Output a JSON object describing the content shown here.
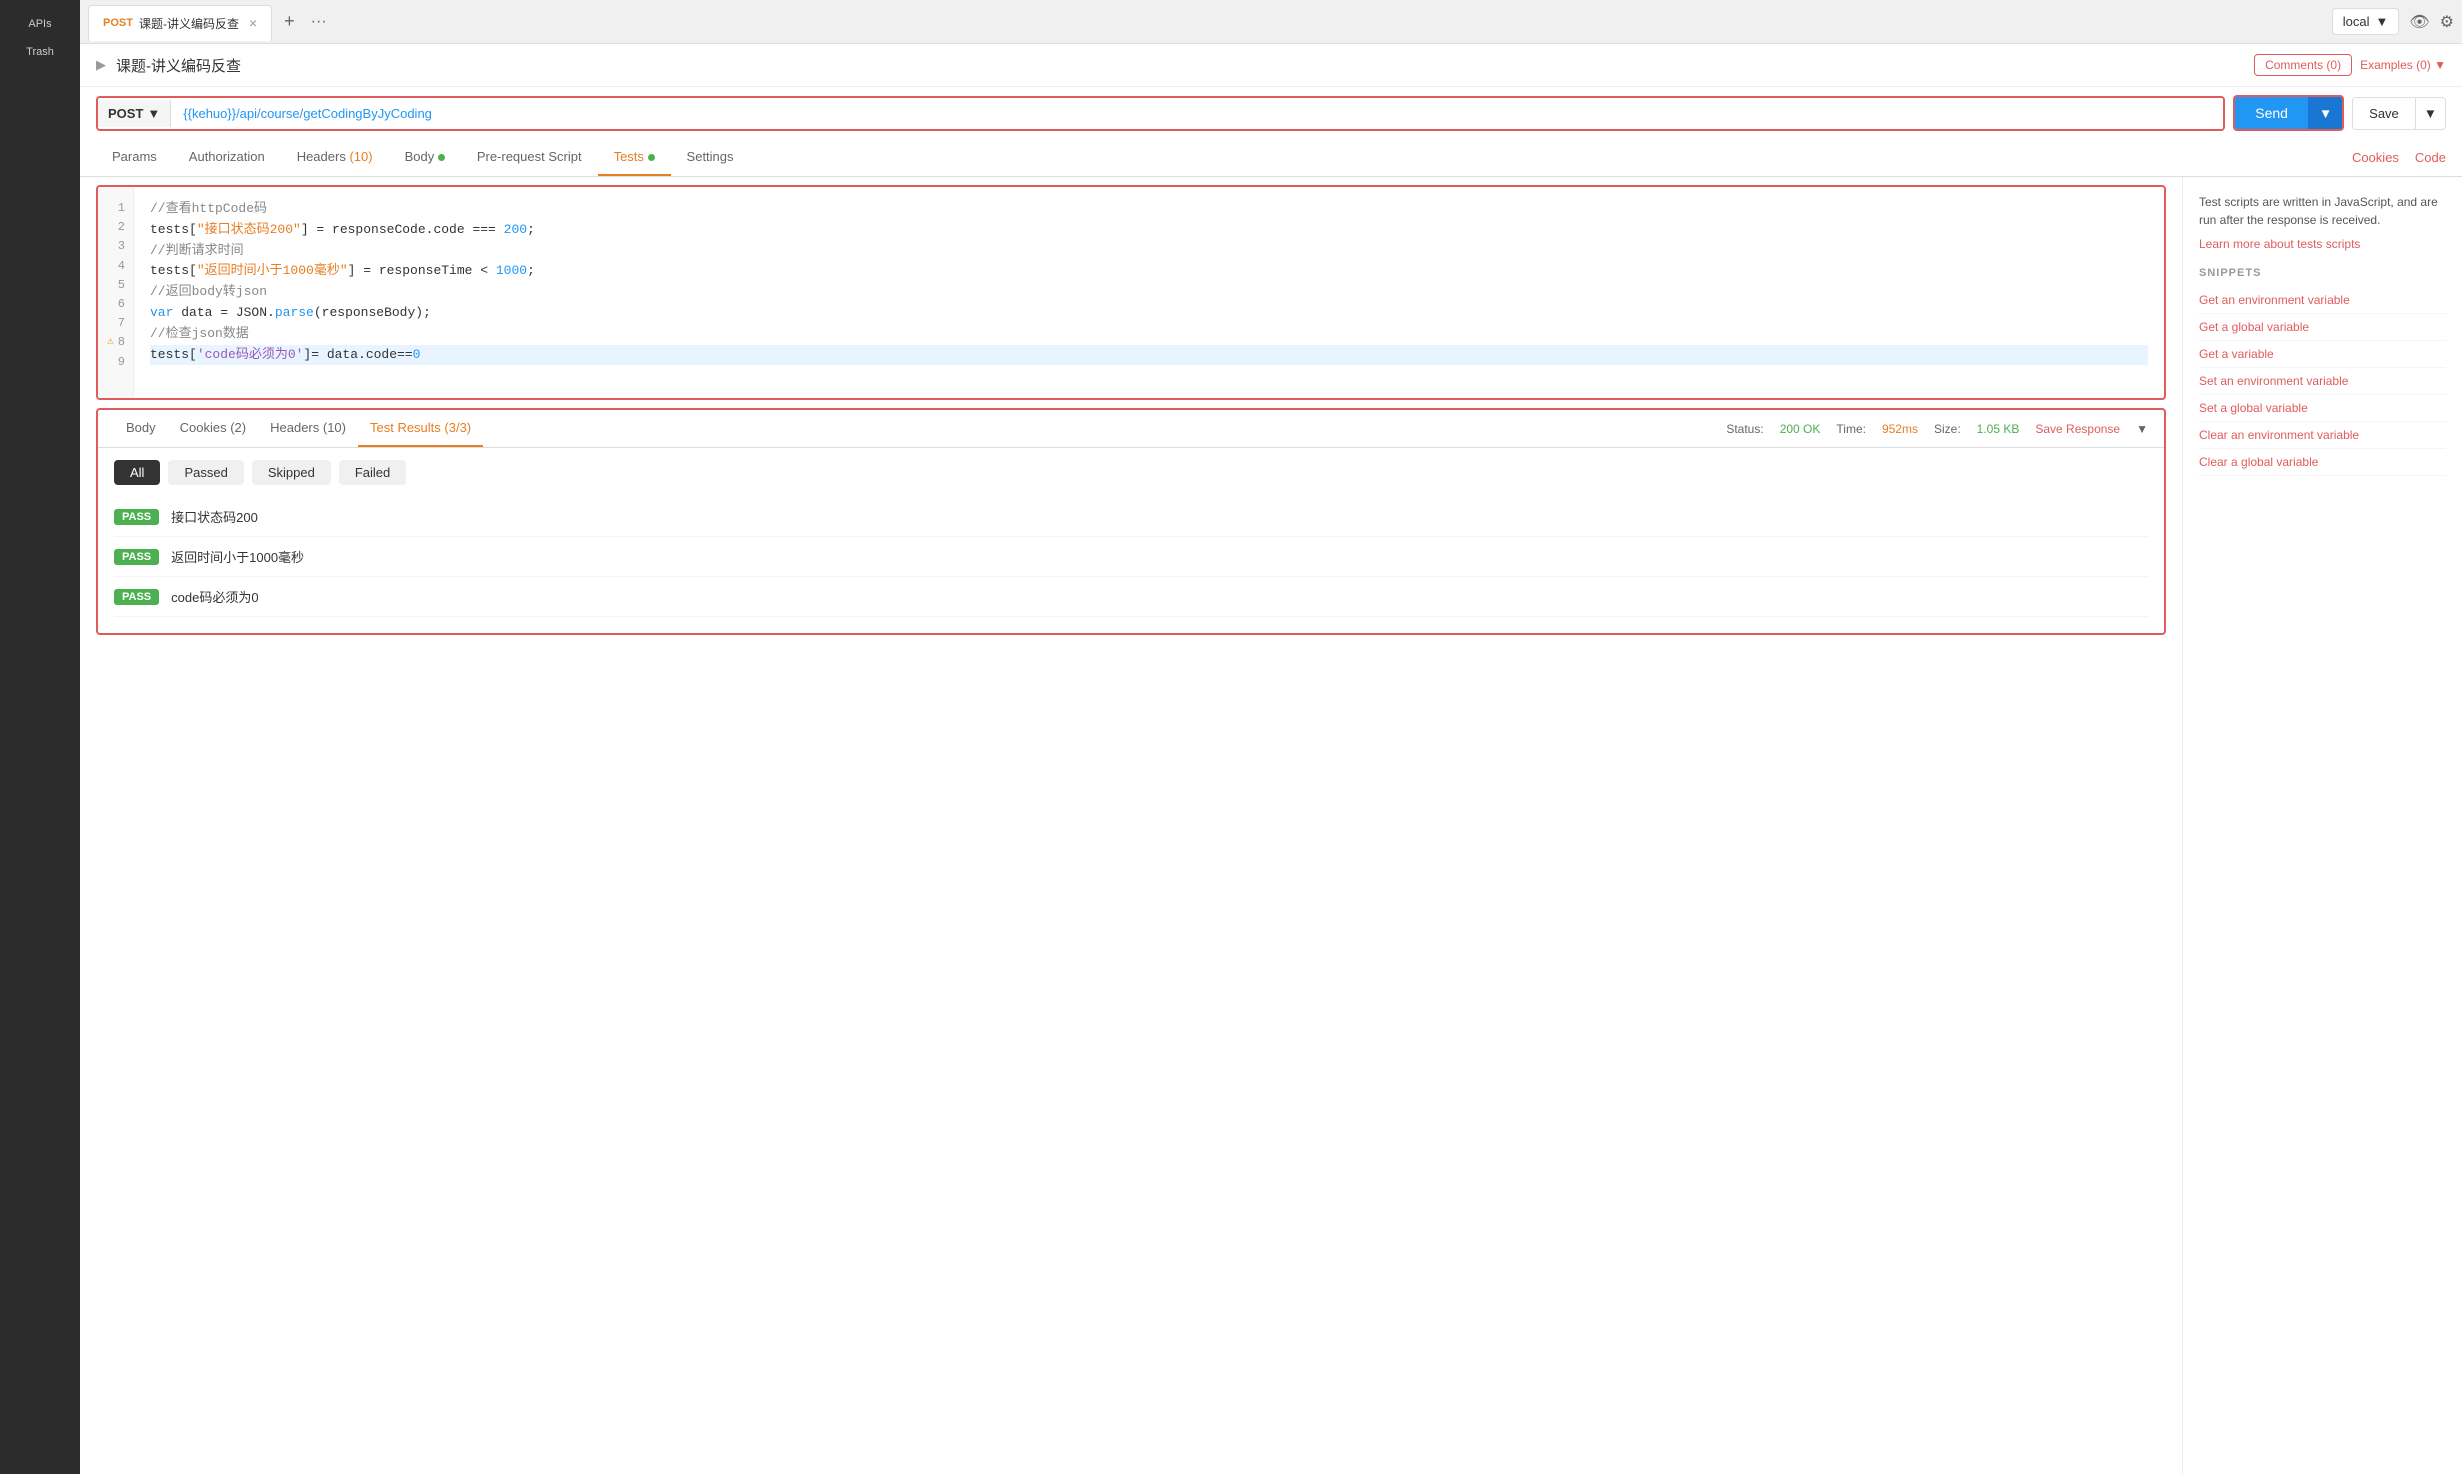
{
  "sidebar": {
    "items": [
      {
        "label": "APIs",
        "id": "apis"
      },
      {
        "label": "Trash",
        "id": "trash"
      }
    ]
  },
  "tab": {
    "method": "POST",
    "name": "课题-讲义编码反查",
    "close_icon": "×"
  },
  "env": {
    "name": "local",
    "dropdown_icon": "▼"
  },
  "request": {
    "breadcrumb_arrow": "▶",
    "name": "课题-讲义编码反查",
    "comments_label": "Comments (0)",
    "examples_label": "Examples (0)",
    "examples_arrow": "▼"
  },
  "url_bar": {
    "method": "POST",
    "url": "{{kehuo}}/api/course/getCodingByJyCoding",
    "send_label": "Send",
    "save_label": "Save"
  },
  "nav_tabs": [
    {
      "label": "Params",
      "active": false,
      "has_dot": false,
      "badge": null
    },
    {
      "label": "Authorization",
      "active": false,
      "has_dot": false,
      "badge": null
    },
    {
      "label": "Headers",
      "active": false,
      "has_dot": false,
      "badge": "(10)"
    },
    {
      "label": "Body",
      "active": false,
      "has_dot": true,
      "badge": null
    },
    {
      "label": "Pre-request Script",
      "active": false,
      "has_dot": false,
      "badge": null
    },
    {
      "label": "Tests",
      "active": true,
      "has_dot": true,
      "badge": null
    },
    {
      "label": "Settings",
      "active": false,
      "has_dot": false,
      "badge": null
    }
  ],
  "right_nav": [
    {
      "label": "Cookies"
    },
    {
      "label": "Code"
    }
  ],
  "code_editor": {
    "lines": [
      {
        "num": 1,
        "warning": false,
        "content": "//查看httpCode码",
        "type": "comment"
      },
      {
        "num": 2,
        "warning": false,
        "content_parts": [
          {
            "text": "tests[",
            "class": "code-var"
          },
          {
            "text": "\"接口状态码200\"",
            "class": "code-string"
          },
          {
            "text": "] = responseCode.code === ",
            "class": "code-var"
          },
          {
            "text": "200",
            "class": "code-number"
          },
          {
            "text": ";",
            "class": "code-var"
          }
        ]
      },
      {
        "num": 3,
        "warning": false,
        "content": "//判断请求时间",
        "type": "comment"
      },
      {
        "num": 4,
        "warning": false,
        "content_parts": [
          {
            "text": "tests[",
            "class": "code-var"
          },
          {
            "text": "\"返回时间小于1000毫秒\"",
            "class": "code-string"
          },
          {
            "text": "] = responseTime < ",
            "class": "code-var"
          },
          {
            "text": "1000",
            "class": "code-number"
          },
          {
            "text": ";",
            "class": "code-var"
          }
        ]
      },
      {
        "num": 5,
        "warning": false,
        "content": "//返回body转json",
        "type": "comment"
      },
      {
        "num": 6,
        "warning": false,
        "content_parts": [
          {
            "text": "var ",
            "class": "code-keyword"
          },
          {
            "text": "data",
            "class": "code-var"
          },
          {
            "text": " = JSON.",
            "class": "code-var"
          },
          {
            "text": "parse",
            "class": "code-method"
          },
          {
            "text": "(responseBody);",
            "class": "code-var"
          }
        ]
      },
      {
        "num": 7,
        "warning": false,
        "content": "//检查json数据",
        "type": "comment"
      },
      {
        "num": 8,
        "warning": true,
        "content_parts": [
          {
            "text": "tests[",
            "class": "code-var"
          },
          {
            "text": "'code码必须为0'",
            "class": "code-key"
          },
          {
            "text": "]= data.code==",
            "class": "code-var"
          },
          {
            "text": "0",
            "class": "code-number"
          }
        ],
        "highlight": true
      },
      {
        "num": 9,
        "warning": false,
        "content": "",
        "type": "empty"
      }
    ]
  },
  "right_panel": {
    "description": "Test scripts are written in JavaScript, and are run after the response is received.",
    "link_text": "Learn more about tests scripts",
    "snippets_title": "SNIPPETS",
    "snippets": [
      "Get an environment variable",
      "Get a global variable",
      "Get a variable",
      "Set an environment variable",
      "Set a global variable",
      "Clear an environment variable",
      "Clear a global variable"
    ]
  },
  "bottom_panel": {
    "tabs": [
      {
        "label": "Body",
        "active": false
      },
      {
        "label": "Cookies (2)",
        "active": false
      },
      {
        "label": "Headers (10)",
        "active": false
      },
      {
        "label": "Test Results (3/3)",
        "active": true
      }
    ],
    "status_label": "Status:",
    "status_value": "200 OK",
    "time_label": "Time:",
    "time_value": "952ms",
    "size_label": "Size:",
    "size_value": "1.05 KB",
    "save_response": "Save Response",
    "save_arrow": "▼"
  },
  "filter_tabs": [
    {
      "label": "All",
      "active": true
    },
    {
      "label": "Passed",
      "active": false
    },
    {
      "label": "Skipped",
      "active": false
    },
    {
      "label": "Failed",
      "active": false
    }
  ],
  "test_results": [
    {
      "badge": "PASS",
      "label": "接口状态码200"
    },
    {
      "badge": "PASS",
      "label": "返回时间小于1000毫秒"
    },
    {
      "badge": "PASS",
      "label": "code码必须为0"
    }
  ]
}
